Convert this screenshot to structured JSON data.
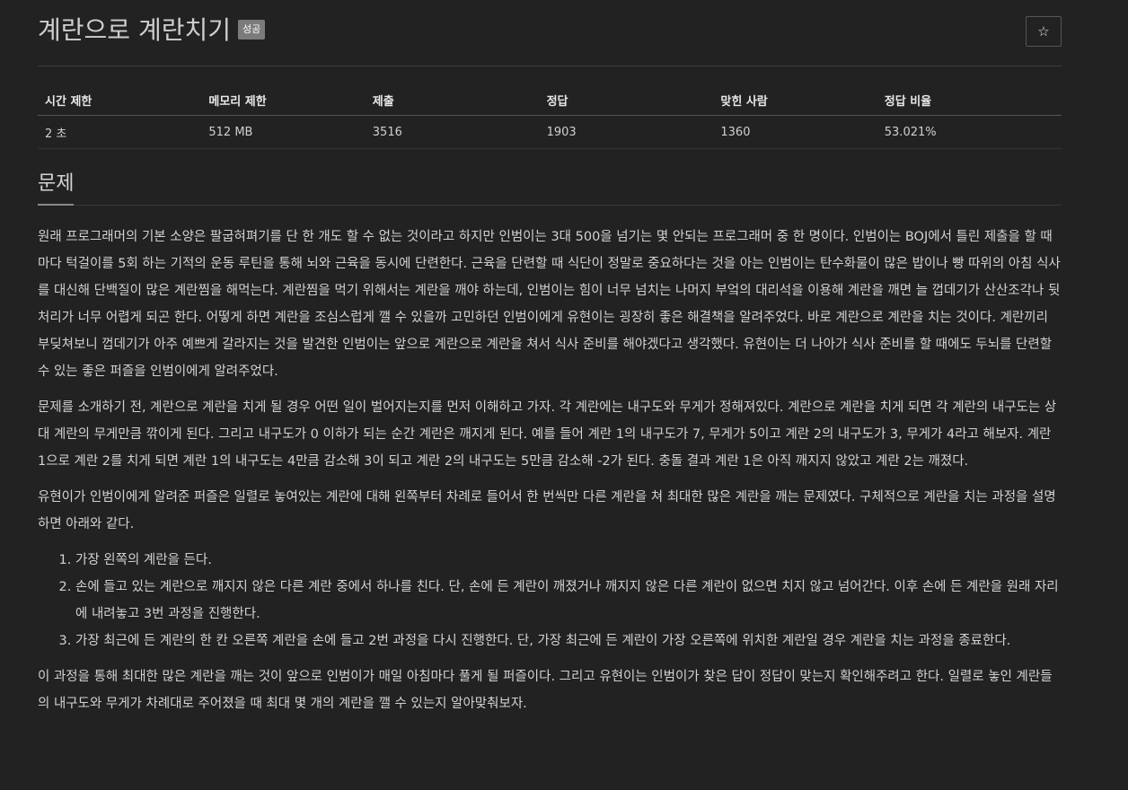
{
  "header": {
    "title": "계란으로 계란치기",
    "badge": "성공",
    "star_label": "☆"
  },
  "stats": {
    "headers": [
      "시간 제한",
      "메모리 제한",
      "제출",
      "정답",
      "맞힌 사람",
      "정답 비율"
    ],
    "values": [
      "2 초",
      "512 MB",
      "3516",
      "1903",
      "1360",
      "53.021%"
    ]
  },
  "section": {
    "title": "문제"
  },
  "problem": {
    "p1": "원래 프로그래머의 기본 소양은 팔굽혀펴기를 단 한 개도 할 수 없는 것이라고 하지만 인범이는 3대 500을 넘기는 몇 안되는 프로그래머 중 한 명이다. 인범이는 BOJ에서 틀린 제출을 할 때마다 턱걸이를 5회 하는 기적의 운동 루틴을 통해 뇌와 근육을 동시에 단련한다. 근육을 단련할 때 식단이 정말로 중요하다는 것을 아는 인범이는 탄수화물이 많은 밥이나 빵 따위의 아침 식사를 대신해 단백질이 많은 계란찜을 해먹는다. 계란찜을 먹기 위해서는 계란을 깨야 하는데, 인범이는 힘이 너무 넘치는 나머지 부엌의 대리석을 이용해 계란을 깨면 늘 껍데기가 산산조각나 뒷처리가 너무 어렵게 되곤 한다. 어떻게 하면 계란을 조심스럽게 깰 수 있을까 고민하던 인범이에게 유현이는 굉장히 좋은 해결책을 알려주었다. 바로 계란으로 계란을 치는 것이다. 계란끼리 부딪쳐보니 껍데기가 아주 예쁘게 갈라지는 것을 발견한 인범이는 앞으로 계란으로 계란을 쳐서 식사 준비를 해야겠다고 생각했다. 유현이는 더 나아가 식사 준비를 할 때에도 두뇌를 단련할 수 있는 좋은 퍼즐을 인범이에게 알려주었다.",
    "p2": "문제를 소개하기 전, 계란으로 계란을 치게 될 경우 어떤 일이 벌어지는지를 먼저 이해하고 가자. 각 계란에는 내구도와 무게가 정해져있다. 계란으로 계란을 치게 되면 각 계란의 내구도는 상대 계란의 무게만큼 깎이게 된다. 그리고 내구도가 0 이하가 되는 순간 계란은 깨지게 된다. 예를 들어 계란 1의 내구도가 7, 무게가 5이고 계란 2의 내구도가 3, 무게가 4라고 해보자. 계란 1으로 계란 2를 치게 되면 계란 1의 내구도는 4만큼 감소해 3이 되고 계란 2의 내구도는 5만큼 감소해 -2가 된다. 충돌 결과 계란 1은 아직 깨지지 않았고 계란 2는 깨졌다.",
    "p3": "유현이가 인범이에게 알려준 퍼즐은 일렬로 놓여있는 계란에 대해 왼쪽부터 차례로 들어서 한 번씩만 다른 계란을 쳐 최대한 많은 계란을 깨는 문제였다. 구체적으로 계란을 치는 과정을 설명하면 아래와 같다.",
    "steps": [
      "가장 왼쪽의 계란을 든다.",
      "손에 들고 있는 계란으로 깨지지 않은 다른 계란 중에서 하나를 친다. 단, 손에 든 계란이 깨졌거나 깨지지 않은 다른 계란이 없으면 치지 않고 넘어간다. 이후 손에 든 계란을 원래 자리에 내려놓고 3번 과정을 진행한다.",
      "가장 최근에 든 계란의 한 칸 오른쪽 계란을 손에 들고 2번 과정을 다시 진행한다. 단, 가장 최근에 든 계란이 가장 오른쪽에 위치한 계란일 경우 계란을 치는 과정을 종료한다."
    ],
    "p4": "이 과정을 통해 최대한 많은 계란을 깨는 것이 앞으로 인범이가 매일 아침마다 풀게 될 퍼즐이다. 그리고 유현이는 인범이가 찾은 답이 정답이 맞는지 확인해주려고 한다. 일렬로 놓인 계란들의 내구도와 무게가 차례대로 주어졌을 때 최대 몇 개의 계란을 깰 수 있는지 알아맞춰보자."
  }
}
